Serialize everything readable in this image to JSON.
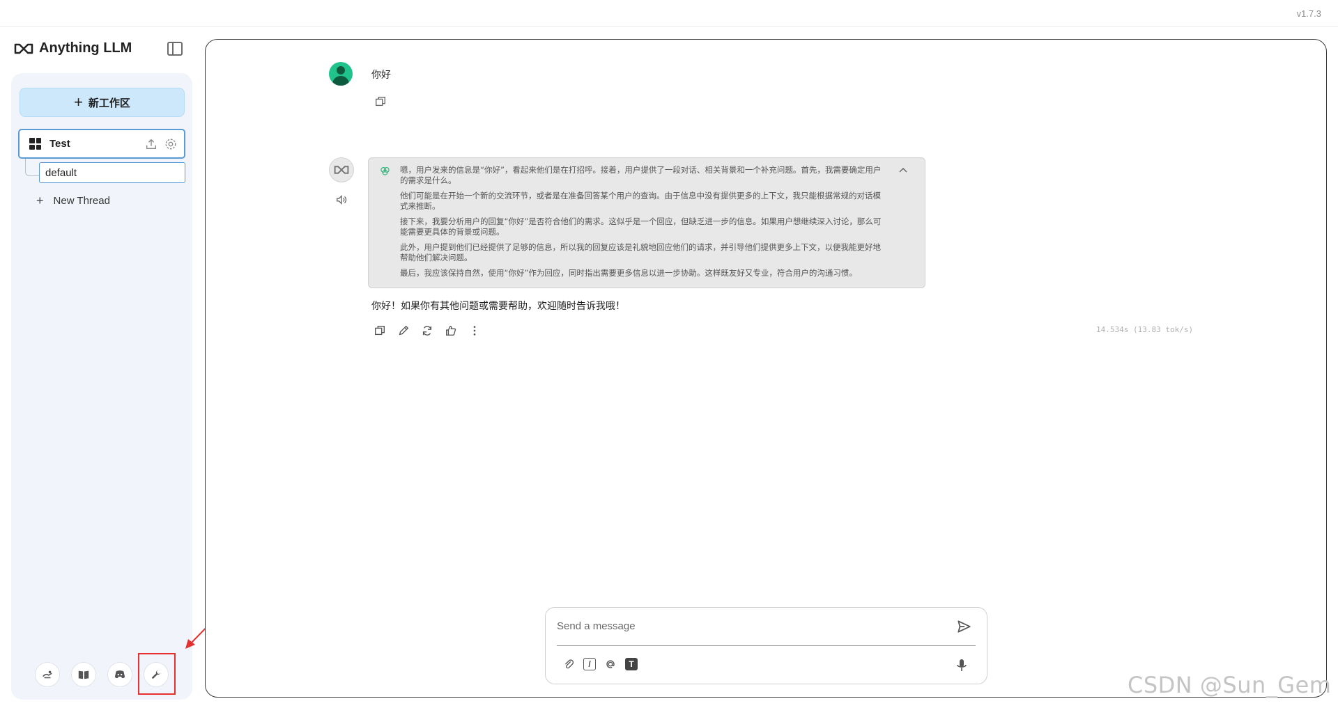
{
  "app": {
    "name": "Anything LLM",
    "version": "v1.7.3"
  },
  "sidebar": {
    "new_workspace_label": "新工作区",
    "workspace": {
      "name": "Test"
    },
    "threads": [
      {
        "label": "default"
      }
    ],
    "new_thread_label": "New Thread",
    "footer_icons": [
      "community-icon",
      "docs-icon",
      "discord-icon",
      "settings-wrench-icon"
    ]
  },
  "chat": {
    "user_message": "你好",
    "thinking": [
      "嗯，用户发来的信息是“你好”，看起来他们是在打招呼。接着，用户提供了一段对话、相关背景和一个补充问题。首先，我需要确定用户的需求是什么。",
      "他们可能是在开始一个新的交流环节，或者是在准备回答某个用户的查询。由于信息中没有提供更多的上下文，我只能根据常规的对话模式来推断。",
      "接下来，我要分析用户的回复“你好”是否符合他们的需求。这似乎是一个回应，但缺乏进一步的信息。如果用户想继续深入讨论，那么可能需要更具体的背景或问题。",
      "此外，用户提到他们已经提供了足够的信息，所以我的回复应该是礼貌地回应他们的请求，并引导他们提供更多上下文，以便我能更好地帮助他们解决问题。",
      "最后，我应该保持自然，使用“你好”作为回应，同时指出需要更多信息以进一步协助。这样既友好又专业，符合用户的沟通习惯。"
    ],
    "ai_answer": "你好！如果你有其他问题或需要帮助，欢迎随时告诉我哦！",
    "metrics": "14.534s (13.83 tok/s)"
  },
  "composer": {
    "placeholder": "Send a message",
    "tools": [
      "attach-icon",
      "slash-command-icon",
      "mention-icon",
      "text-format-icon"
    ]
  },
  "watermark": "CSDN @Sun_Gem"
}
